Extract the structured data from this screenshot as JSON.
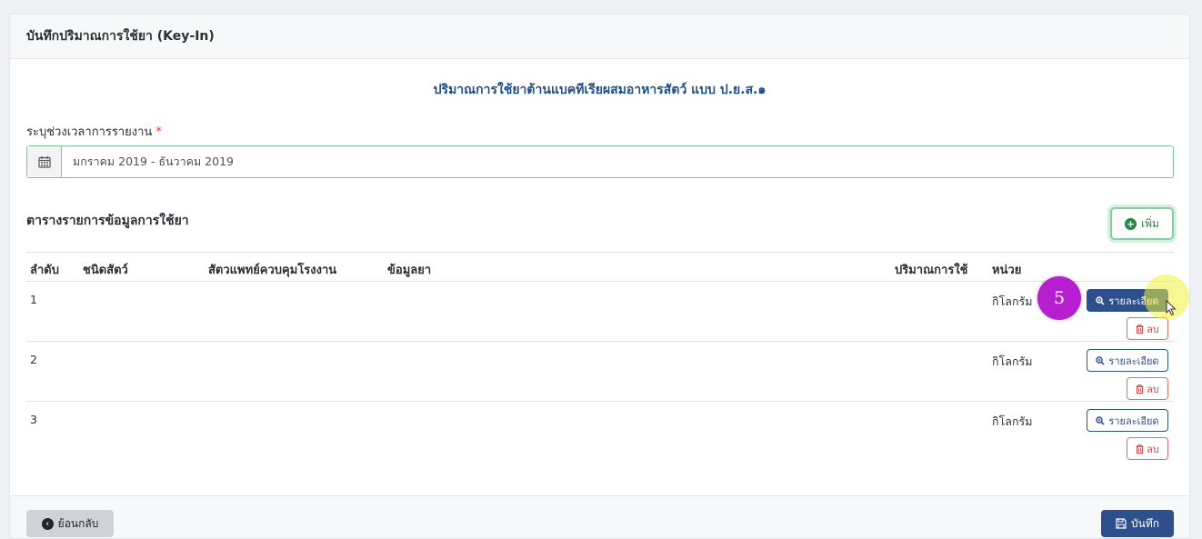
{
  "header": {
    "title": "บันทึกปริมาณการใช้ยา (Key-In)"
  },
  "form": {
    "title": "ปริมาณการใช้ยาต้านแบคทีเรียผสมอาหารสัตว์ แบบ ป.ย.ส.๑",
    "period_label": "ระบุช่วงเวลาการรายงาน",
    "required_mark": "*",
    "period_value": "มกราคม 2019 - ธันวาคม 2019"
  },
  "table": {
    "heading": "ตารางรายการข้อมูลการใช้ยา",
    "add_label": "เพิ่ม",
    "columns": [
      "ลำดับ",
      "ชนิดสัตว์",
      "สัตวแพทย์ควบคุมโรงงาน",
      "ข้อมูลยา",
      "ปริมาณการใช้",
      "หน่วย"
    ],
    "rows": [
      {
        "index": "1",
        "unit": "กิโลกรัม",
        "detail_label": "รายละเอียด",
        "delete_label": "ลบ"
      },
      {
        "index": "2",
        "unit": "กิโลกรัม",
        "detail_label": "รายละเอียด",
        "delete_label": "ลบ"
      },
      {
        "index": "3",
        "unit": "กิโลกรัม",
        "detail_label": "รายละเอียด",
        "delete_label": "ลบ"
      }
    ]
  },
  "footer": {
    "back_label": "ย้อนกลับ",
    "save_label": "บันทึก"
  },
  "overlay": {
    "step_number": "5"
  },
  "colors": {
    "primary": "#2d4f8b",
    "success": "#1f8a45",
    "danger": "#d44343",
    "step_badge": "#b61fd0"
  },
  "icons": [
    "calendar-icon",
    "plus-circle-icon",
    "zoom-icon",
    "trash-icon",
    "arrow-left-circle-icon",
    "save-icon",
    "cursor-icon"
  ]
}
